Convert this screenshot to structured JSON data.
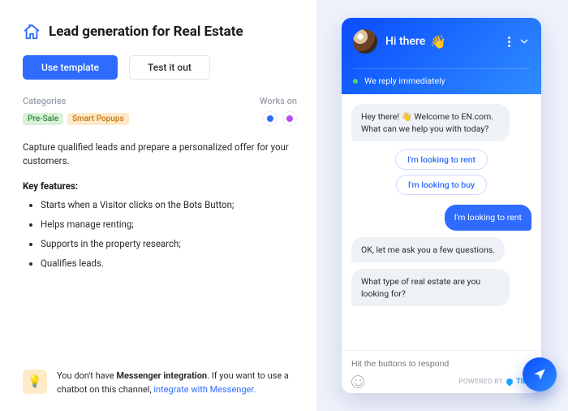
{
  "header": {
    "title": "Lead generation for Real Estate"
  },
  "buttons": {
    "use_template": "Use template",
    "test_it_out": "Test it out"
  },
  "meta": {
    "categories_label": "Categories",
    "works_on_label": "Works on"
  },
  "tags": [
    {
      "label": "Pre-Sale",
      "variant": "green"
    },
    {
      "label": "Smart Popups",
      "variant": "orange"
    }
  ],
  "channels": [
    {
      "name": "chat-channel",
      "color": "#2f6bff"
    },
    {
      "name": "messenger-channel",
      "color": "#b44bff"
    }
  ],
  "description": "Capture qualified leads and prepare a personalized offer for your customers.",
  "features": {
    "heading": "Key features:",
    "items": [
      "Starts when a Visitor clicks on the Bots Button;",
      "Helps manage renting;",
      "Supports in the property research;",
      "Qualifies leads."
    ]
  },
  "notice": {
    "prefix": "You don't have ",
    "bold": "Messenger integration",
    "middle": ". If you want to use a chatbot on this channel, ",
    "link": "integrate with Messenger.",
    "icon": "💡"
  },
  "chat": {
    "greeting": "Hi there",
    "wave": "👋",
    "status": "We reply immediately",
    "messages": {
      "welcome": "Hey there! 👋 Welcome to EN.com. What can we help you with today?",
      "quick_rent": "I'm looking to rent",
      "quick_buy": "I'm looking to buy",
      "user_pick": "I'm looking to rent",
      "followup1": "OK, let me ask you a few questions.",
      "followup2": "What type of real estate are you looking for?"
    },
    "input_placeholder": "Hit the buttons to respond",
    "powered_label": "POWERED BY",
    "brand": "TIDIO"
  }
}
